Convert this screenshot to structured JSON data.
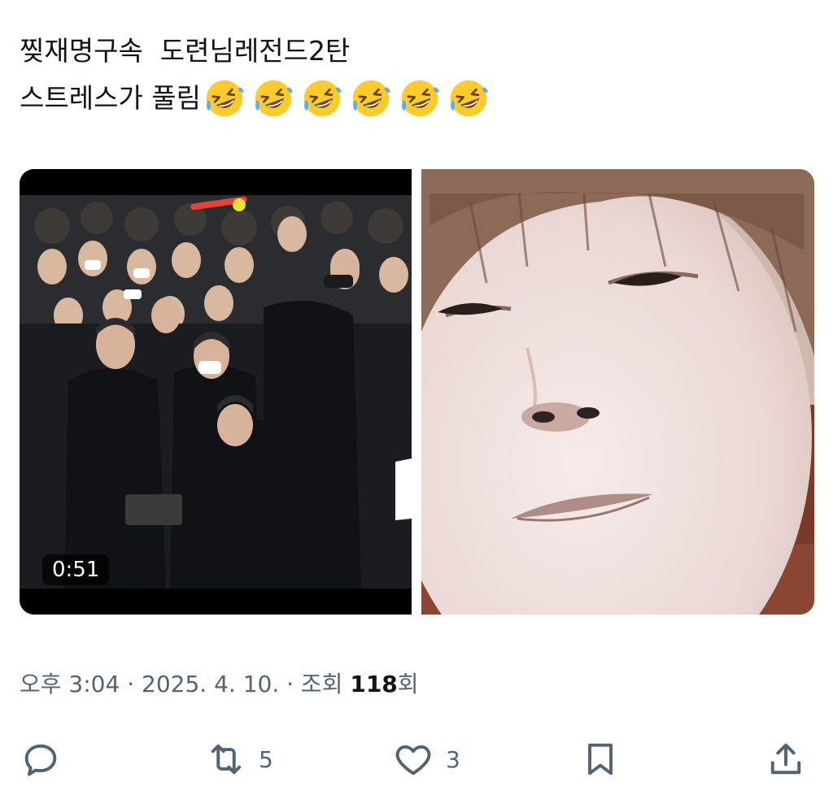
{
  "tweet": {
    "line1": "찢재명구속  도련님레전드2탄",
    "line2": "스트레스가 풀림",
    "emoji_name": "rolling-on-the-floor-laughing-icon",
    "emoji_count": 6
  },
  "media": {
    "video_duration": "0:51"
  },
  "meta": {
    "time": "오후 3:04",
    "separator": " · ",
    "date": "2025. 4. 10.",
    "views_prefix": "조회 ",
    "views_count": "118",
    "views_suffix": "회"
  },
  "actions": {
    "reply_count": "",
    "retweet_count": "5",
    "like_count": "3"
  },
  "colors": {
    "text": "#0f1419",
    "secondary": "#536471",
    "emoji_face": "#ffcb2c"
  }
}
